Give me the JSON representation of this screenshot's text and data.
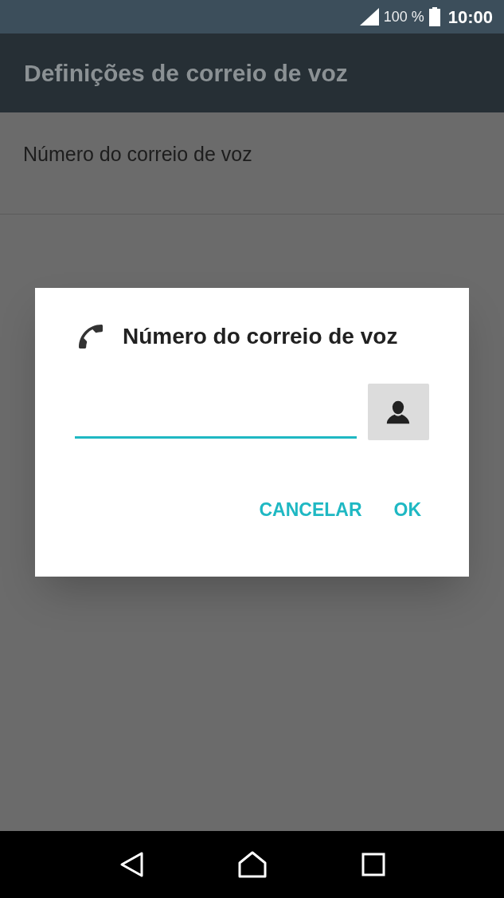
{
  "status_bar": {
    "battery": "100 %",
    "time": "10:00"
  },
  "app_bar": {
    "title": "Definições de correio de voz"
  },
  "settings": [
    {
      "label": "Número do correio de voz"
    }
  ],
  "dialog": {
    "title": "Número do correio de voz",
    "buttons": [
      "CANCELAR",
      "OK"
    ]
  }
}
